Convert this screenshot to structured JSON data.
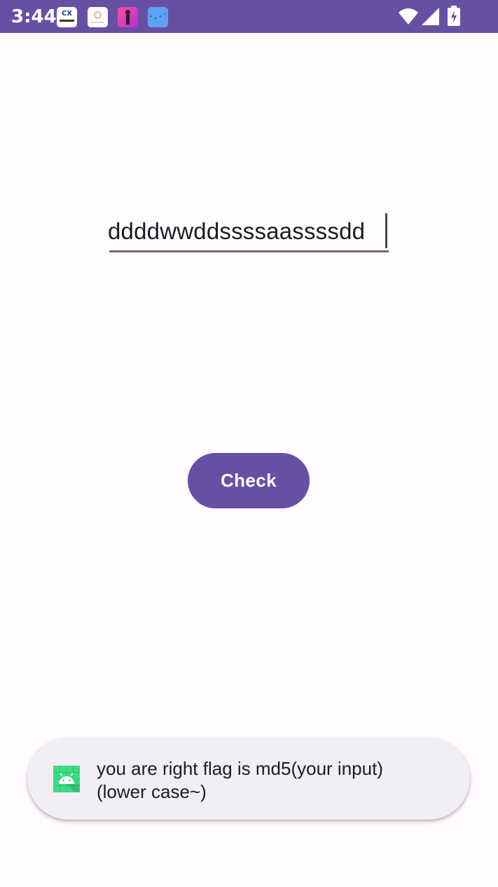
{
  "status_bar": {
    "time": "3:44",
    "notification_icons": [
      {
        "name": "cx-app-icon",
        "text": "CX"
      },
      {
        "name": "photo-app-icon"
      },
      {
        "name": "dance-app-icon"
      },
      {
        "name": "face-app-icon",
        "text": "·.·′"
      }
    ],
    "system_icons": [
      "wifi-icon",
      "signal-icon",
      "battery-charging-icon"
    ],
    "background_color": "#6750a4"
  },
  "main": {
    "input": {
      "value": "ddddwwddssssaassssdd",
      "placeholder": ""
    },
    "check_button": {
      "label": "Check",
      "color": "#6750a4"
    }
  },
  "toast": {
    "icon": "android-app-icon",
    "message_line1": "you are right flag is md5(your input)",
    "message_line2": "(lower case~)"
  },
  "colors": {
    "accent": "#6750a4",
    "background": "#fffbfe",
    "toast_background": "#f1eff3",
    "android_icon": "#3ddc84"
  }
}
